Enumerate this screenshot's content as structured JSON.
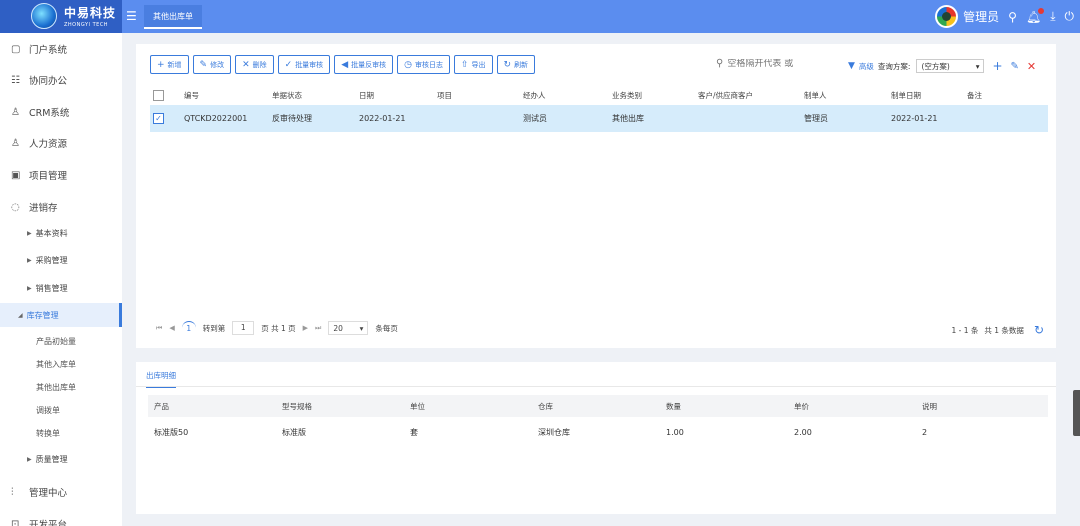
{
  "header": {
    "brand_cn": "中易科技",
    "brand_en": "ZHONGYI TECH",
    "active_tab": "其他出库单",
    "username": "管理员",
    "icons": [
      "menu-icon",
      "search-icon",
      "bell-icon",
      "download-icon",
      "power-icon"
    ]
  },
  "sidebar": {
    "items": [
      {
        "label": "门户系统",
        "icon": "portal-icon"
      },
      {
        "label": "协同办公",
        "icon": "office-icon"
      },
      {
        "label": "CRM系统",
        "icon": "crm-icon"
      },
      {
        "label": "人力资源",
        "icon": "hr-icon"
      },
      {
        "label": "项目管理",
        "icon": "project-icon"
      },
      {
        "label": "进销存",
        "icon": "inventory-icon"
      }
    ],
    "sub_items": [
      {
        "label": "基本资料"
      },
      {
        "label": "采购管理"
      },
      {
        "label": "销售管理"
      },
      {
        "label": "库存管理"
      }
    ],
    "leaf_items": [
      {
        "label": "产品初始量"
      },
      {
        "label": "其他入库单"
      },
      {
        "label": "其他出库单"
      },
      {
        "label": "调拨单"
      },
      {
        "label": "转换单"
      }
    ],
    "quality": "质量管理",
    "bottom_items": [
      {
        "label": "管理中心"
      },
      {
        "label": "开发平台"
      }
    ]
  },
  "toolbar": {
    "buttons": [
      {
        "label": "新增",
        "icon": "plus-icon"
      },
      {
        "label": "修改",
        "icon": "edit-icon"
      },
      {
        "label": "删除",
        "icon": "delete-icon"
      },
      {
        "label": "批量审核",
        "icon": "check-icon"
      },
      {
        "label": "批量反审核",
        "icon": "undo-icon"
      },
      {
        "label": "审核日志",
        "icon": "log-icon"
      },
      {
        "label": "导出",
        "icon": "export-icon"
      },
      {
        "label": "刷新",
        "icon": "refresh-icon"
      }
    ],
    "search_placeholder": "空格隔开代表 或",
    "advanced": "高级",
    "scheme_label": "查询方案:",
    "scheme_value": "(空方案)"
  },
  "table": {
    "columns": [
      "编号",
      "单据状态",
      "日期",
      "项目",
      "经办人",
      "业务类别",
      "客户/供应商客户",
      "制单人",
      "制单日期",
      "备注"
    ],
    "rows": [
      {
        "code": "QTCKD2022001",
        "status": "反审待处理",
        "date": "2022-01-21",
        "project": "",
        "handler": "测试员",
        "category": "其他出库",
        "customer": "",
        "maker": "管理员",
        "make_date": "2022-01-21",
        "note": "",
        "checked": true
      }
    ]
  },
  "pager": {
    "current_page": "1",
    "goto_label": "转到第",
    "goto_value": "1",
    "page_total": "页 共 1 页",
    "page_size": "20",
    "per_page": "条每页",
    "range": "1 - 1 条",
    "total": "共 1 条数据"
  },
  "detail": {
    "tab": "出库明细",
    "columns": [
      "产品",
      "型号规格",
      "单位",
      "仓库",
      "数量",
      "单价",
      "说明"
    ],
    "rows": [
      {
        "product": "标准版50",
        "spec": "标准版",
        "unit": "套",
        "warehouse": "深圳仓库",
        "qty": "1.00",
        "price": "2.00",
        "desc": "2"
      }
    ]
  }
}
